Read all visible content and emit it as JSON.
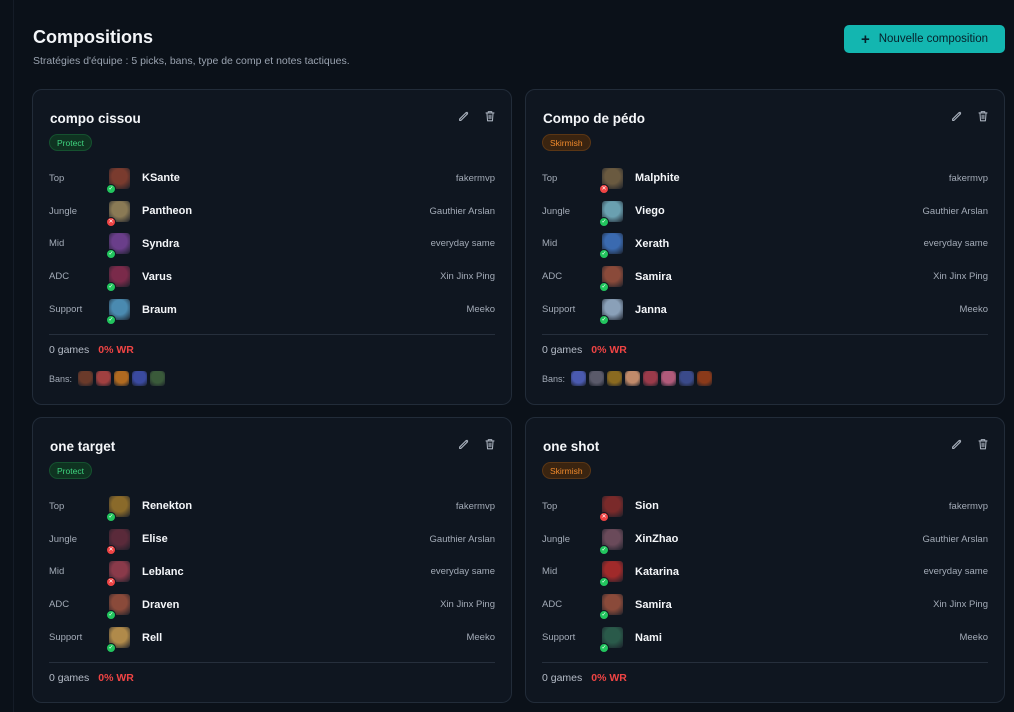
{
  "header": {
    "title": "Compositions",
    "subtitle": "Stratégies d'équipe : 5 picks, bans, type de comp et notes tactiques.",
    "new_button_label": "Nouvelle composition"
  },
  "colors": {
    "accent": "#13b6b0",
    "protect": "#3fd47f",
    "skirmish": "#f08a2c",
    "loss": "#ef4444",
    "ok": "#22c55e"
  },
  "icons": {
    "edit": "pencil-icon",
    "delete": "trash-icon",
    "add": "plus-icon",
    "check": "check-icon",
    "cross": "x-icon"
  },
  "compositions": [
    {
      "name": "compo cissou",
      "type": "Protect",
      "picks": [
        {
          "role": "Top",
          "champion": "KSante",
          "player": "fakermvp",
          "status": "ok",
          "color": "#7a3b2e"
        },
        {
          "role": "Jungle",
          "champion": "Pantheon",
          "player": "Gauthier Arslan",
          "status": "no",
          "color": "#8a7a55"
        },
        {
          "role": "Mid",
          "champion": "Syndra",
          "player": "everyday same",
          "status": "ok",
          "color": "#6a3e8a"
        },
        {
          "role": "ADC",
          "champion": "Varus",
          "player": "Xin Jinx Ping",
          "status": "ok",
          "color": "#7a2a4a"
        },
        {
          "role": "Support",
          "champion": "Braum",
          "player": "Meeko",
          "status": "ok",
          "color": "#4a8ab0"
        }
      ],
      "games": "0 games",
      "winrate": "0% WR",
      "bans_label": "Bans:",
      "bans": [
        "#6a3a2a",
        "#a04040",
        "#b06a20",
        "#3a4aa0",
        "#3a5a3a"
      ]
    },
    {
      "name": "Compo de pédo",
      "type": "Skirmish",
      "picks": [
        {
          "role": "Top",
          "champion": "Malphite",
          "player": "fakermvp",
          "status": "no",
          "color": "#6a5a40"
        },
        {
          "role": "Jungle",
          "champion": "Viego",
          "player": "Gauthier Arslan",
          "status": "ok",
          "color": "#6aa0b0"
        },
        {
          "role": "Mid",
          "champion": "Xerath",
          "player": "everyday same",
          "status": "ok",
          "color": "#3a6ab0"
        },
        {
          "role": "ADC",
          "champion": "Samira",
          "player": "Xin Jinx Ping",
          "status": "ok",
          "color": "#8a4a3a"
        },
        {
          "role": "Support",
          "champion": "Janna",
          "player": "Meeko",
          "status": "ok",
          "color": "#8aa0b8"
        }
      ],
      "games": "0 games",
      "winrate": "0% WR",
      "bans_label": "Bans:",
      "bans": [
        "#4a5ab0",
        "#5a5a6a",
        "#8a6a20",
        "#c08a6a",
        "#9a3a4a",
        "#b05a7a",
        "#3a4a8a",
        "#8a3a1a"
      ]
    },
    {
      "name": "one target",
      "type": "Protect",
      "picks": [
        {
          "role": "Top",
          "champion": "Renekton",
          "player": "fakermvp",
          "status": "ok",
          "color": "#8a6a2a"
        },
        {
          "role": "Jungle",
          "champion": "Elise",
          "player": "Gauthier Arslan",
          "status": "no",
          "color": "#5a2a3a"
        },
        {
          "role": "Mid",
          "champion": "Leblanc",
          "player": "everyday same",
          "status": "no",
          "color": "#8a3a4a"
        },
        {
          "role": "ADC",
          "champion": "Draven",
          "player": "Xin Jinx Ping",
          "status": "ok",
          "color": "#8a4a3a"
        },
        {
          "role": "Support",
          "champion": "Rell",
          "player": "Meeko",
          "status": "ok",
          "color": "#b08a4a"
        }
      ],
      "games": "0 games",
      "winrate": "0% WR"
    },
    {
      "name": "one shot",
      "type": "Skirmish",
      "picks": [
        {
          "role": "Top",
          "champion": "Sion",
          "player": "fakermvp",
          "status": "no",
          "color": "#7a2a2a"
        },
        {
          "role": "Jungle",
          "champion": "XinZhao",
          "player": "Gauthier Arslan",
          "status": "ok",
          "color": "#6a4a5a"
        },
        {
          "role": "Mid",
          "champion": "Katarina",
          "player": "everyday same",
          "status": "ok",
          "color": "#a02a2a"
        },
        {
          "role": "ADC",
          "champion": "Samira",
          "player": "Xin Jinx Ping",
          "status": "ok",
          "color": "#8a4a3a"
        },
        {
          "role": "Support",
          "champion": "Nami",
          "player": "Meeko",
          "status": "ok",
          "color": "#2a5a4a"
        }
      ],
      "games": "0 games",
      "winrate": "0% WR"
    }
  ]
}
